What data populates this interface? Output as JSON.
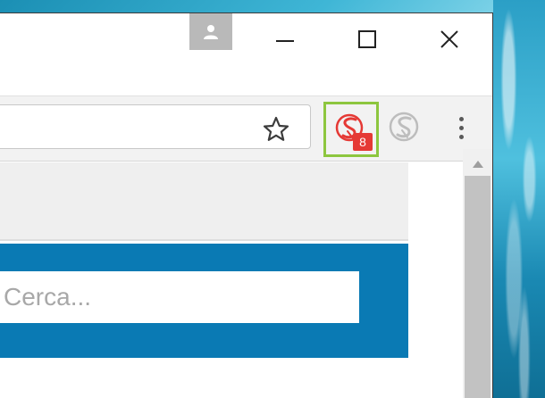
{
  "titlebar": {
    "profile_icon": "person-icon",
    "minimize_icon": "minimize-icon",
    "maximize_icon": "maximize-icon",
    "close_icon": "close-icon"
  },
  "toolbar": {
    "bookmark_icon": "star-icon",
    "extension_active": {
      "icon": "extension-s-logo-icon",
      "badge": "8",
      "color": "#e53935",
      "highlight_color": "#8dc63f"
    },
    "extension_inactive": {
      "icon": "extension-s-logo-icon",
      "color": "#bdbdbd"
    },
    "menu_icon": "kebab-menu-icon"
  },
  "page": {
    "search": {
      "placeholder": "Cerca..."
    },
    "search_band_color": "#0a7ab4"
  }
}
